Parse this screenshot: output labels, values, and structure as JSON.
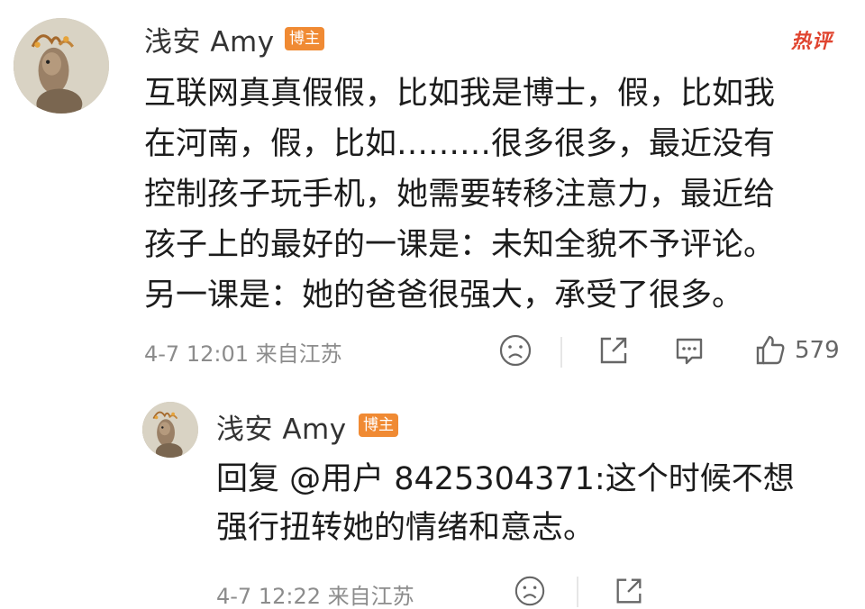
{
  "main_comment": {
    "username": "浅安 Amy",
    "badge": "博主",
    "hot_label": "热评",
    "lines": [
      "互联网真真假假，比如我是博士，假，比如我",
      "在河南，假，比如………很多很多，最近没有",
      "控制孩子玩手机，她需要转移注意力，最近给",
      "孩子上的最好的一课是：未知全貌不予评论。",
      "另一课是：她的爸爸很强大，承受了很多。"
    ],
    "meta": "4-7 12:01 来自江苏",
    "like_count": "579",
    "icons": [
      "sad-face-icon",
      "share-icon",
      "comment-icon",
      "like-icon"
    ]
  },
  "reply_comment": {
    "username": "浅安 Amy",
    "badge": "博主",
    "lines": [
      "回复 @用户 8425304371:这个时候不想",
      "强行扭转她的情绪和意志。"
    ],
    "meta": "4-7 12:22 来自江苏",
    "icons": [
      "sad-face-icon",
      "share-icon"
    ]
  },
  "colors": {
    "badge": "#f08a33",
    "hot": "#e0442f",
    "meta": "#8c8c8c"
  }
}
